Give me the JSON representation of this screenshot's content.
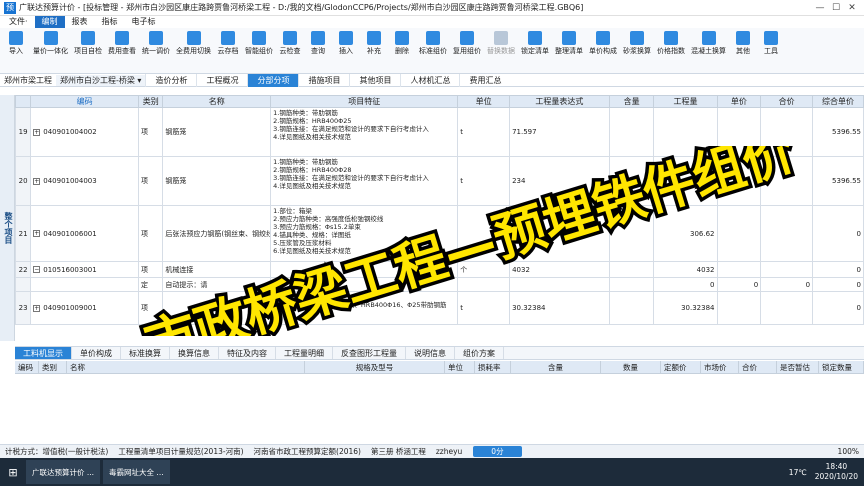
{
  "window": {
    "title": "广联达预算计价 - [投标管理 - 郑州市白沙园区康庄路跨贾鲁河桥梁工程 - D:/我的文档/GlodonCCP6/Projects/郑州市白沙园区康庄路跨贾鲁河桥梁工程.GBQ6]",
    "logo": "预"
  },
  "menu": [
    "文件·",
    "编制",
    "报表",
    "指标",
    "电子标"
  ],
  "toolbar": [
    {
      "label": "导入",
      "icon": "import-icon"
    },
    {
      "label": "量价一体化",
      "icon": "integration-icon"
    },
    {
      "label": "项目自检",
      "icon": "check-icon"
    },
    {
      "label": "费用查看",
      "icon": "fee-view-icon"
    },
    {
      "label": "统一调价",
      "icon": "adjust-price-icon"
    },
    {
      "label": "全费用切换",
      "icon": "switch-icon"
    },
    {
      "label": "云存档",
      "icon": "cloud-save-icon"
    },
    {
      "label": "智能组价",
      "icon": "smart-price-icon"
    },
    {
      "label": "云检查",
      "icon": "cloud-check-icon"
    },
    {
      "label": "查询",
      "icon": "query-icon"
    },
    {
      "label": "插入",
      "icon": "insert-icon"
    },
    {
      "label": "补充",
      "icon": "supplement-icon"
    },
    {
      "label": "删除",
      "icon": "delete-icon"
    },
    {
      "label": "标准组价",
      "icon": "standard-price-icon"
    },
    {
      "label": "复用组价",
      "icon": "reuse-price-icon"
    },
    {
      "label": "替换数据",
      "icon": "replace-data-icon",
      "dim": true
    },
    {
      "label": "锁定清单",
      "icon": "lock-list-icon"
    },
    {
      "label": "整理清单",
      "icon": "organize-icon"
    },
    {
      "label": "单价构成",
      "icon": "unit-price-icon"
    },
    {
      "label": "砂浆换算",
      "icon": "mortar-icon"
    },
    {
      "label": "价格指数",
      "icon": "price-index-icon"
    },
    {
      "label": "混凝土换算",
      "icon": "concrete-icon"
    },
    {
      "label": "其他",
      "icon": "other-icon"
    },
    {
      "label": "工具",
      "icon": "tools-icon"
    }
  ],
  "breadcrumb": {
    "project": "郑州市梁工程",
    "unit": "郑州市白沙工程-桥梁 ▾"
  },
  "tabs": [
    "造价分析",
    "工程概况",
    "分部分项",
    "措施项目",
    "其他项目",
    "人材机汇总",
    "费用汇总"
  ],
  "selected_tab": "分部分项",
  "left_strip": "整个项目",
  "columns": [
    "编码",
    "类别",
    "名称",
    "项目特征",
    "单位",
    "工程量表达式",
    "含量",
    "工程量",
    "单价",
    "合价",
    "综合单价"
  ],
  "rows": [
    {
      "no": "19",
      "code": "040901004002",
      "type": "项",
      "name": "钢筋笼",
      "feature": "1.钢筋种类：带肋钢筋\n2.钢筋规格：HRB400Φ25\n3.钢筋连接：在满足规范和设计的要求下自行考虑计入\n4.详见图纸及相关技术规范",
      "unit": "t",
      "expr": "71.597",
      "content": "",
      "qty": "",
      "price": "",
      "total": "",
      "unitcost": "5396.55"
    },
    {
      "no": "20",
      "code": "040901004003",
      "type": "项",
      "name": "钢筋笼",
      "feature": "1.钢筋种类：带肋钢筋\n2.钢筋规格：HRB400Φ28\n3.钢筋连接：在满足规范和设计的要求下自行考虑计入\n4.详见图纸及相关技术规范",
      "unit": "t",
      "expr": "234",
      "content": "",
      "qty": "234.612",
      "price": "",
      "total": "",
      "unitcost": "5396.55"
    },
    {
      "no": "21",
      "code": "040901006001",
      "type": "项",
      "name": "后张法预应力钢筋(钢丝束、钢绞线)",
      "feature": "1.部位：箱梁\n2.预应力筋种类：高强度低松弛钢绞线\n3.预应力筋规格：Φs15.2单束\n4.锚具种类、规格：详图纸\n5.压浆管及压浆材料\n6.详见图纸及相关技术规范",
      "unit": "",
      "expr": "",
      "content": "",
      "qty": "306.62",
      "price": "",
      "total": "",
      "unitcost": "0"
    },
    {
      "no": "22",
      "code": "010516003001",
      "type": "项",
      "name": "机械连接",
      "feature": "",
      "unit": "个",
      "expr": "4032",
      "content": "",
      "qty": "4032",
      "price": "",
      "total": "",
      "unitcost": "0"
    },
    {
      "no": "",
      "code": "",
      "type": "定",
      "name": "自动提示：请",
      "feature": "",
      "unit": "",
      "expr": "",
      "content": "",
      "qty": "0",
      "price": "0",
      "total": "0",
      "unitcost": "0"
    },
    {
      "no": "23",
      "code": "040901009001",
      "type": "项",
      "name": "",
      "feature": "1.钢板、带肋钢筋\n2.材料规格：20、30厚钢板、HRB400Φ16、Φ25带肋钢筋",
      "unit": "t",
      "expr": "30.32384",
      "content": "",
      "qty": "30.32384",
      "price": "",
      "total": "",
      "unitcost": "0"
    }
  ],
  "overlay_text": "市政桥梁工程—预埋铁件组价",
  "bottom_tabs": [
    "工料机显示",
    "单价构成",
    "标准换算",
    "换算信息",
    "特征及内容",
    "工程量明细",
    "反查图形工程量",
    "说明信息",
    "组价方案"
  ],
  "bottom_columns": [
    "编码",
    "类别",
    "名称",
    "规格及型号",
    "单位",
    "损耗率",
    "含量",
    "数量",
    "定额价",
    "市场价",
    "合价",
    "是否暂估",
    "锁定数量"
  ],
  "status": {
    "tax": "计税方式：增值税(一般计税法)",
    "rule": "工程量清单项目计量规范(2013-河南)",
    "quota": "河南省市政工程预算定额(2016)",
    "chapter": "第三册 桥涵工程",
    "user": "zzheyu",
    "score": "0分",
    "zoom": "100%"
  },
  "taskbar": {
    "apps": [
      "广联达预算计价 ...",
      "毒霸网址大全 ..."
    ],
    "temp": "17℃",
    "time": "18:40",
    "date": "2020/10/20"
  },
  "colors": {
    "accent": "#2a83d6",
    "overlay_fill": "#ffe600",
    "overlay_stroke": "#000000"
  }
}
